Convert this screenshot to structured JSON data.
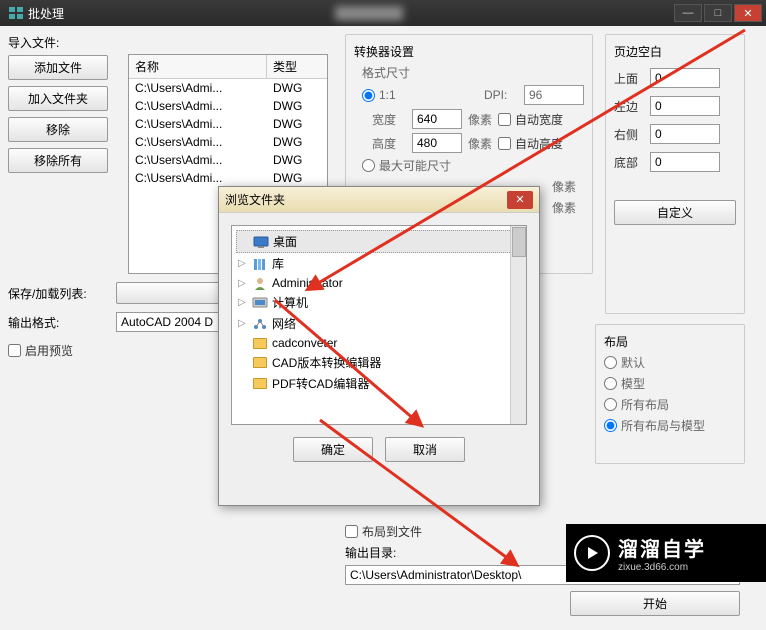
{
  "titlebar": {
    "title": "批处理"
  },
  "left": {
    "import_label": "导入文件:",
    "add_file": "添加文件",
    "add_folder": "加入文件夹",
    "remove": "移除",
    "remove_all": "移除所有",
    "col_name": "名称",
    "col_type": "类型",
    "files": [
      {
        "name": "C:\\Users\\Admi...",
        "type": "DWG"
      },
      {
        "name": "C:\\Users\\Admi...",
        "type": "DWG"
      },
      {
        "name": "C:\\Users\\Admi...",
        "type": "DWG"
      },
      {
        "name": "C:\\Users\\Admi...",
        "type": "DWG"
      },
      {
        "name": "C:\\Users\\Admi...",
        "type": "DWG"
      },
      {
        "name": "C:\\Users\\Admi...",
        "type": "DWG"
      }
    ],
    "save_load_label": "保存/加载列表:",
    "output_format_label": "输出格式:",
    "output_format_value": "AutoCAD 2004 D",
    "enable_preview": "启用预览"
  },
  "converter": {
    "title": "转换器设置",
    "size_label": "格式尺寸",
    "ratio": "1:1",
    "dpi_label": "DPI:",
    "dpi_value": "96",
    "width_label": "宽度",
    "width_value": "640",
    "height_label": "高度",
    "height_value": "480",
    "pixel": "像素",
    "auto_width": "自动宽度",
    "auto_height": "自动高度",
    "max_dim": "最大可能尺寸"
  },
  "margins": {
    "title": "页边空白",
    "top": "上面",
    "top_v": "0",
    "left": "左边",
    "left_v": "0",
    "right": "右侧",
    "right_v": "0",
    "bottom": "底部",
    "bottom_v": "0",
    "custom": "自定义"
  },
  "layout": {
    "title": "布局",
    "default": "默认",
    "model": "模型",
    "all_layouts": "所有布局",
    "all_layouts_model": "所有布局与模型"
  },
  "output": {
    "layout_to_file": "布局到文件",
    "dir_label": "输出目录:",
    "dir_value": "C:\\Users\\Administrator\\Desktop\\",
    "start": "开始"
  },
  "dialog": {
    "title": "浏览文件夹",
    "items": [
      {
        "icon": "desktop",
        "label": "桌面",
        "selected": true
      },
      {
        "icon": "lib",
        "label": "库",
        "arrow": "▷"
      },
      {
        "icon": "user",
        "label": "Administrator",
        "arrow": "▷"
      },
      {
        "icon": "computer",
        "label": "计算机",
        "arrow": "▷"
      },
      {
        "icon": "network",
        "label": "网络",
        "arrow": "▷"
      },
      {
        "icon": "folder",
        "label": "cadconveter"
      },
      {
        "icon": "folder",
        "label": "CAD版本转换编辑器"
      },
      {
        "icon": "folder",
        "label": "PDF转CAD编辑器"
      }
    ],
    "ok": "确定",
    "cancel": "取消"
  },
  "watermark": {
    "brand": "溜溜自学",
    "url": "zixue.3d66.com"
  }
}
